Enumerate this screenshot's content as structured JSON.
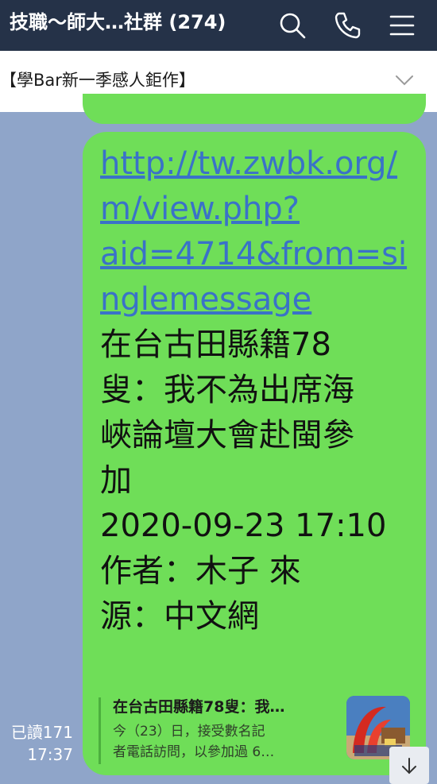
{
  "header": {
    "title": "技職～師大…社群 (274)",
    "icons": [
      "search-icon",
      "phone-icon",
      "menu-icon"
    ],
    "bg_color": "#253248"
  },
  "announcement": {
    "text": "【學Bar新一季感人鉅作】"
  },
  "message": {
    "link_lines": [
      "http://tw.zwbk.org/",
      "m/view.php?",
      "aid=4714&from=si",
      "nglemessage"
    ],
    "body_lines": [
      "在台古田縣籍78",
      "叟：我不為出席海",
      "峽論壇大會赴閩參",
      "加",
      "2020-09-23 17:10",
      "作者：木子  來",
      "源：中文網"
    ],
    "bubble_color": "#6fde58",
    "link_color": "#3a72c8"
  },
  "link_preview": {
    "title": "在台古田縣籍78叟：我…",
    "description_lines": [
      "今（23）日，接受數名記",
      "者電話訪問，以參加過 6…"
    ]
  },
  "read_status": {
    "read_label": "已讀171",
    "time": "17:37"
  }
}
